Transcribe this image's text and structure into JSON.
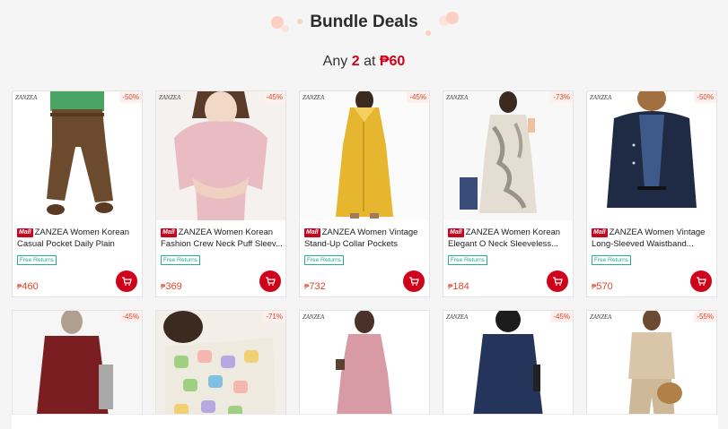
{
  "header": {
    "title": "Bundle Deals",
    "offer_prefix": "Any",
    "offer_count": "2",
    "offer_mid": "at",
    "offer_price": "₱60"
  },
  "currency": "₱",
  "mall_badge": "Mall",
  "free_returns_label": "Free Returns",
  "brand_logo": "ZANZEA",
  "colors": {
    "accent": "#d0011b",
    "price": "#e2452b",
    "free_returns": "#26aa99"
  },
  "products_row1": [
    {
      "discount": "-50%",
      "name": "ZANZEA Women Korean Casual Pocket Daily Plain Colo...",
      "price": "460"
    },
    {
      "discount": "-45%",
      "name": "ZANZEA Women Korean Fashion Crew Neck Puff Sleev...",
      "price": "369"
    },
    {
      "discount": "-45%",
      "name": "ZANZEA Women Vintage Stand-Up Collar Pockets Long-...",
      "price": "732"
    },
    {
      "discount": "-73%",
      "name": "ZANZEA Women Korean Elegant O Neck Sleeveless...",
      "price": "184"
    },
    {
      "discount": "-50%",
      "name": "ZANZEA Women Vintage Long-Sleeved Waistband...",
      "price": "570"
    }
  ],
  "products_row2": [
    {
      "discount": "-45%"
    },
    {
      "discount": "-71%"
    },
    {
      "discount": ""
    },
    {
      "discount": "-45%"
    },
    {
      "discount": "-55%"
    }
  ]
}
